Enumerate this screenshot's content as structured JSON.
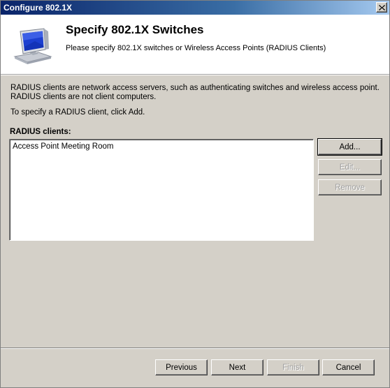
{
  "window": {
    "title": "Configure 802.1X"
  },
  "header": {
    "title": "Specify 802.1X Switches",
    "subtitle": "Please specify 802.1X switches or Wireless Access Points (RADIUS Clients)",
    "icon": "computer-monitor-icon"
  },
  "body": {
    "description_line1": "RADIUS clients are network access servers, such as authenticating switches and wireless access point.",
    "description_line2": "RADIUS clients are not client computers.",
    "instruction": "To specify a RADIUS client, click Add.",
    "list_label": "RADIUS clients:",
    "items": [
      "Access Point Meeting Room"
    ]
  },
  "side_buttons": {
    "add": "Add...",
    "edit": "Edit...",
    "remove": "Remove"
  },
  "nav_buttons": {
    "previous": "Previous",
    "next": "Next",
    "finish": "Finish",
    "cancel": "Cancel"
  }
}
